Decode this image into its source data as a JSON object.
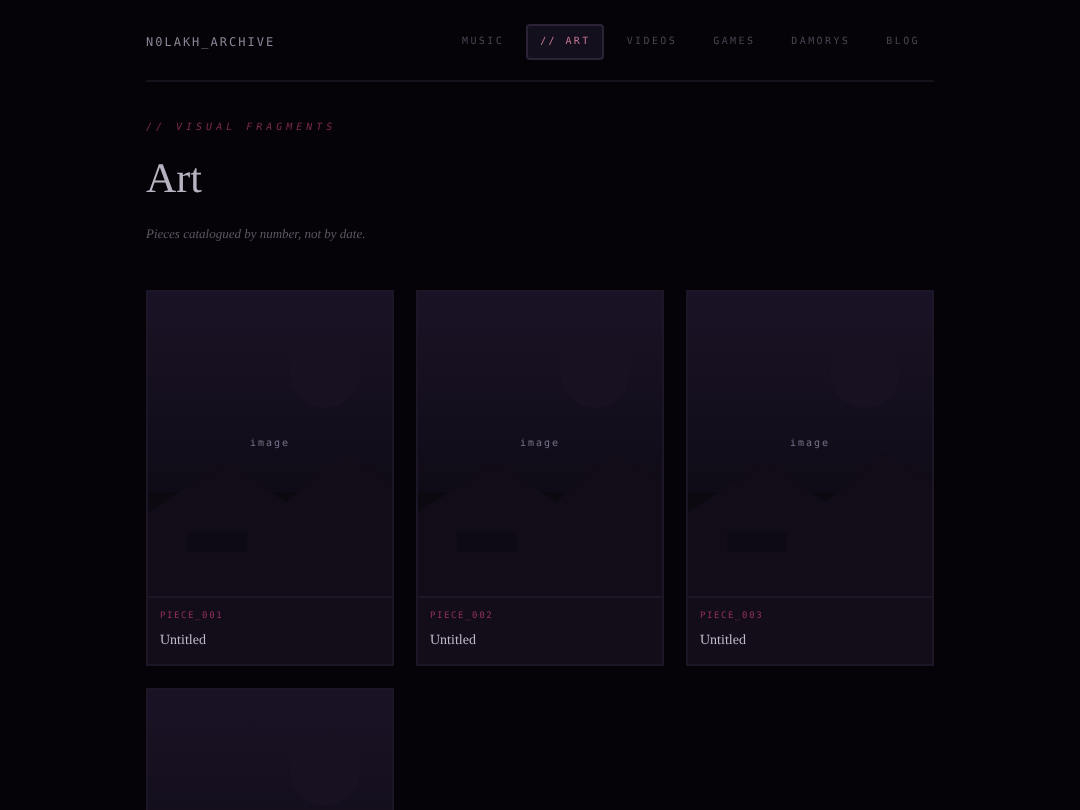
{
  "header": {
    "logo": "N0LAKH_ARCHIVE",
    "nav": [
      {
        "label": "MUSIC",
        "selected": false
      },
      {
        "label": "// ART",
        "selected": true
      },
      {
        "label": "VIDEOS",
        "selected": false
      },
      {
        "label": "GAMES",
        "selected": false
      },
      {
        "label": "DAMORYS",
        "selected": false
      },
      {
        "label": "BLOG",
        "selected": false
      }
    ]
  },
  "section": {
    "eyebrow": "// VISUAL FRAGMENTS",
    "title": "Art",
    "subtitle": "Pieces catalogued by number, not by date."
  },
  "pieces": [
    {
      "kind": "card",
      "image_label": "image",
      "code": "PIECE_001",
      "title": "Untitled"
    },
    {
      "kind": "card",
      "image_label": "image",
      "code": "PIECE_002",
      "title": "Untitled"
    },
    {
      "kind": "card",
      "image_label": "image",
      "code": "PIECE_003",
      "title": "Untitled"
    },
    {
      "kind": "picture"
    }
  ]
}
